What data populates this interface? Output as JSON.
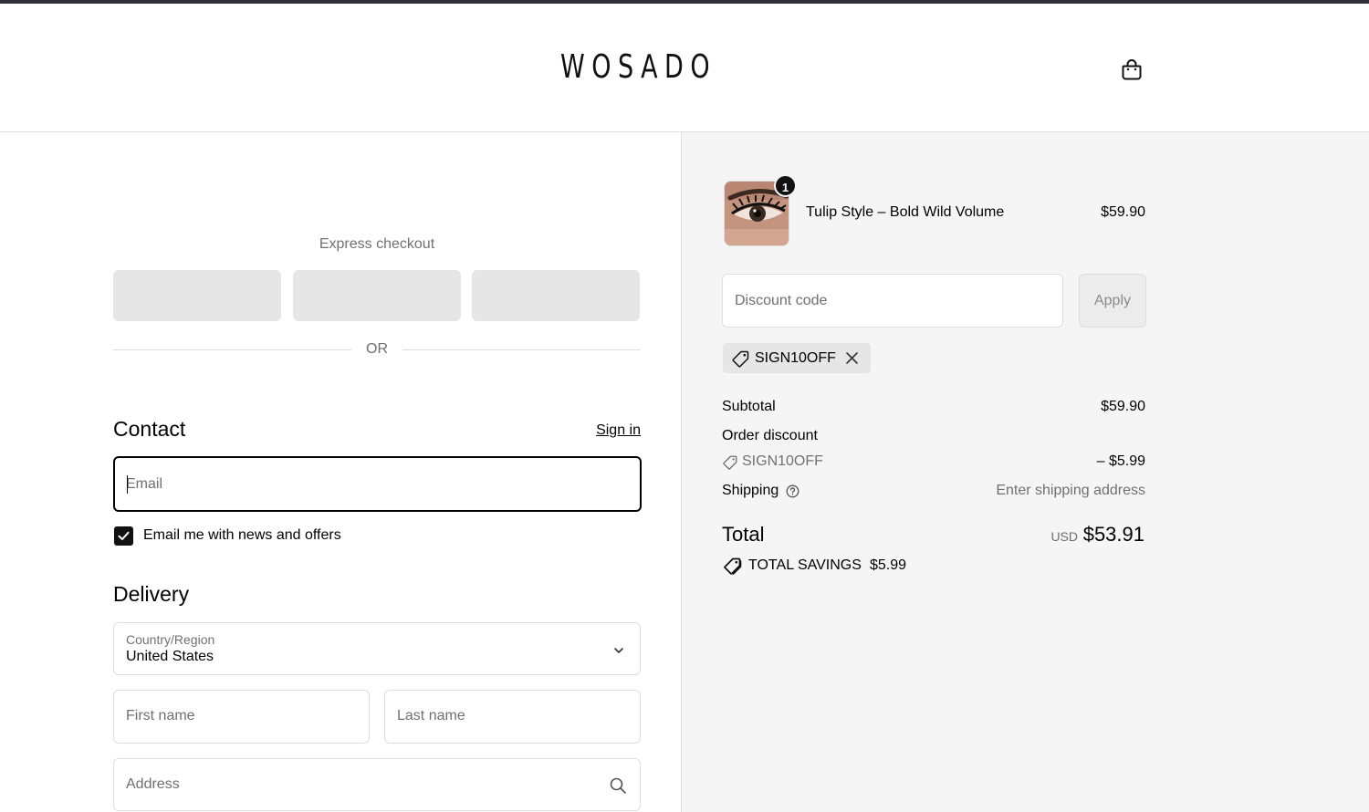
{
  "header": {
    "brand": "WOSADO",
    "cart_icon": "shopping-bag-icon"
  },
  "checkout": {
    "express_title": "Express checkout",
    "or_text": "OR",
    "contact": {
      "title": "Contact",
      "sign_in": "Sign in",
      "email_placeholder": "Email",
      "email_value": "",
      "newsletter_label": "Email me with news and offers",
      "newsletter_checked": true
    },
    "delivery": {
      "title": "Delivery",
      "country_label": "Country/Region",
      "country_value": "United States",
      "first_name_placeholder": "First name",
      "last_name_placeholder": "Last name",
      "address_placeholder": "Address"
    }
  },
  "summary": {
    "item": {
      "quantity": "1",
      "name": "Tulip Style – Bold Wild Volume",
      "price": "$59.90"
    },
    "discount": {
      "placeholder": "Discount code",
      "apply_label": "Apply",
      "applied_code": "SIGN10OFF"
    },
    "subtotal_label": "Subtotal",
    "subtotal_value": "$59.90",
    "order_discount_label": "Order discount",
    "order_discount_code": "SIGN10OFF",
    "order_discount_value": "– $5.99",
    "shipping_label": "Shipping",
    "shipping_value": "Enter shipping address",
    "total_label": "Total",
    "total_currency": "USD",
    "total_value": "$53.91",
    "savings_label": "TOTAL SAVINGS",
    "savings_value": "$5.99"
  },
  "colors": {
    "accent": "#111111",
    "panel_bg": "#f5f5f5",
    "muted_text": "#707070"
  }
}
